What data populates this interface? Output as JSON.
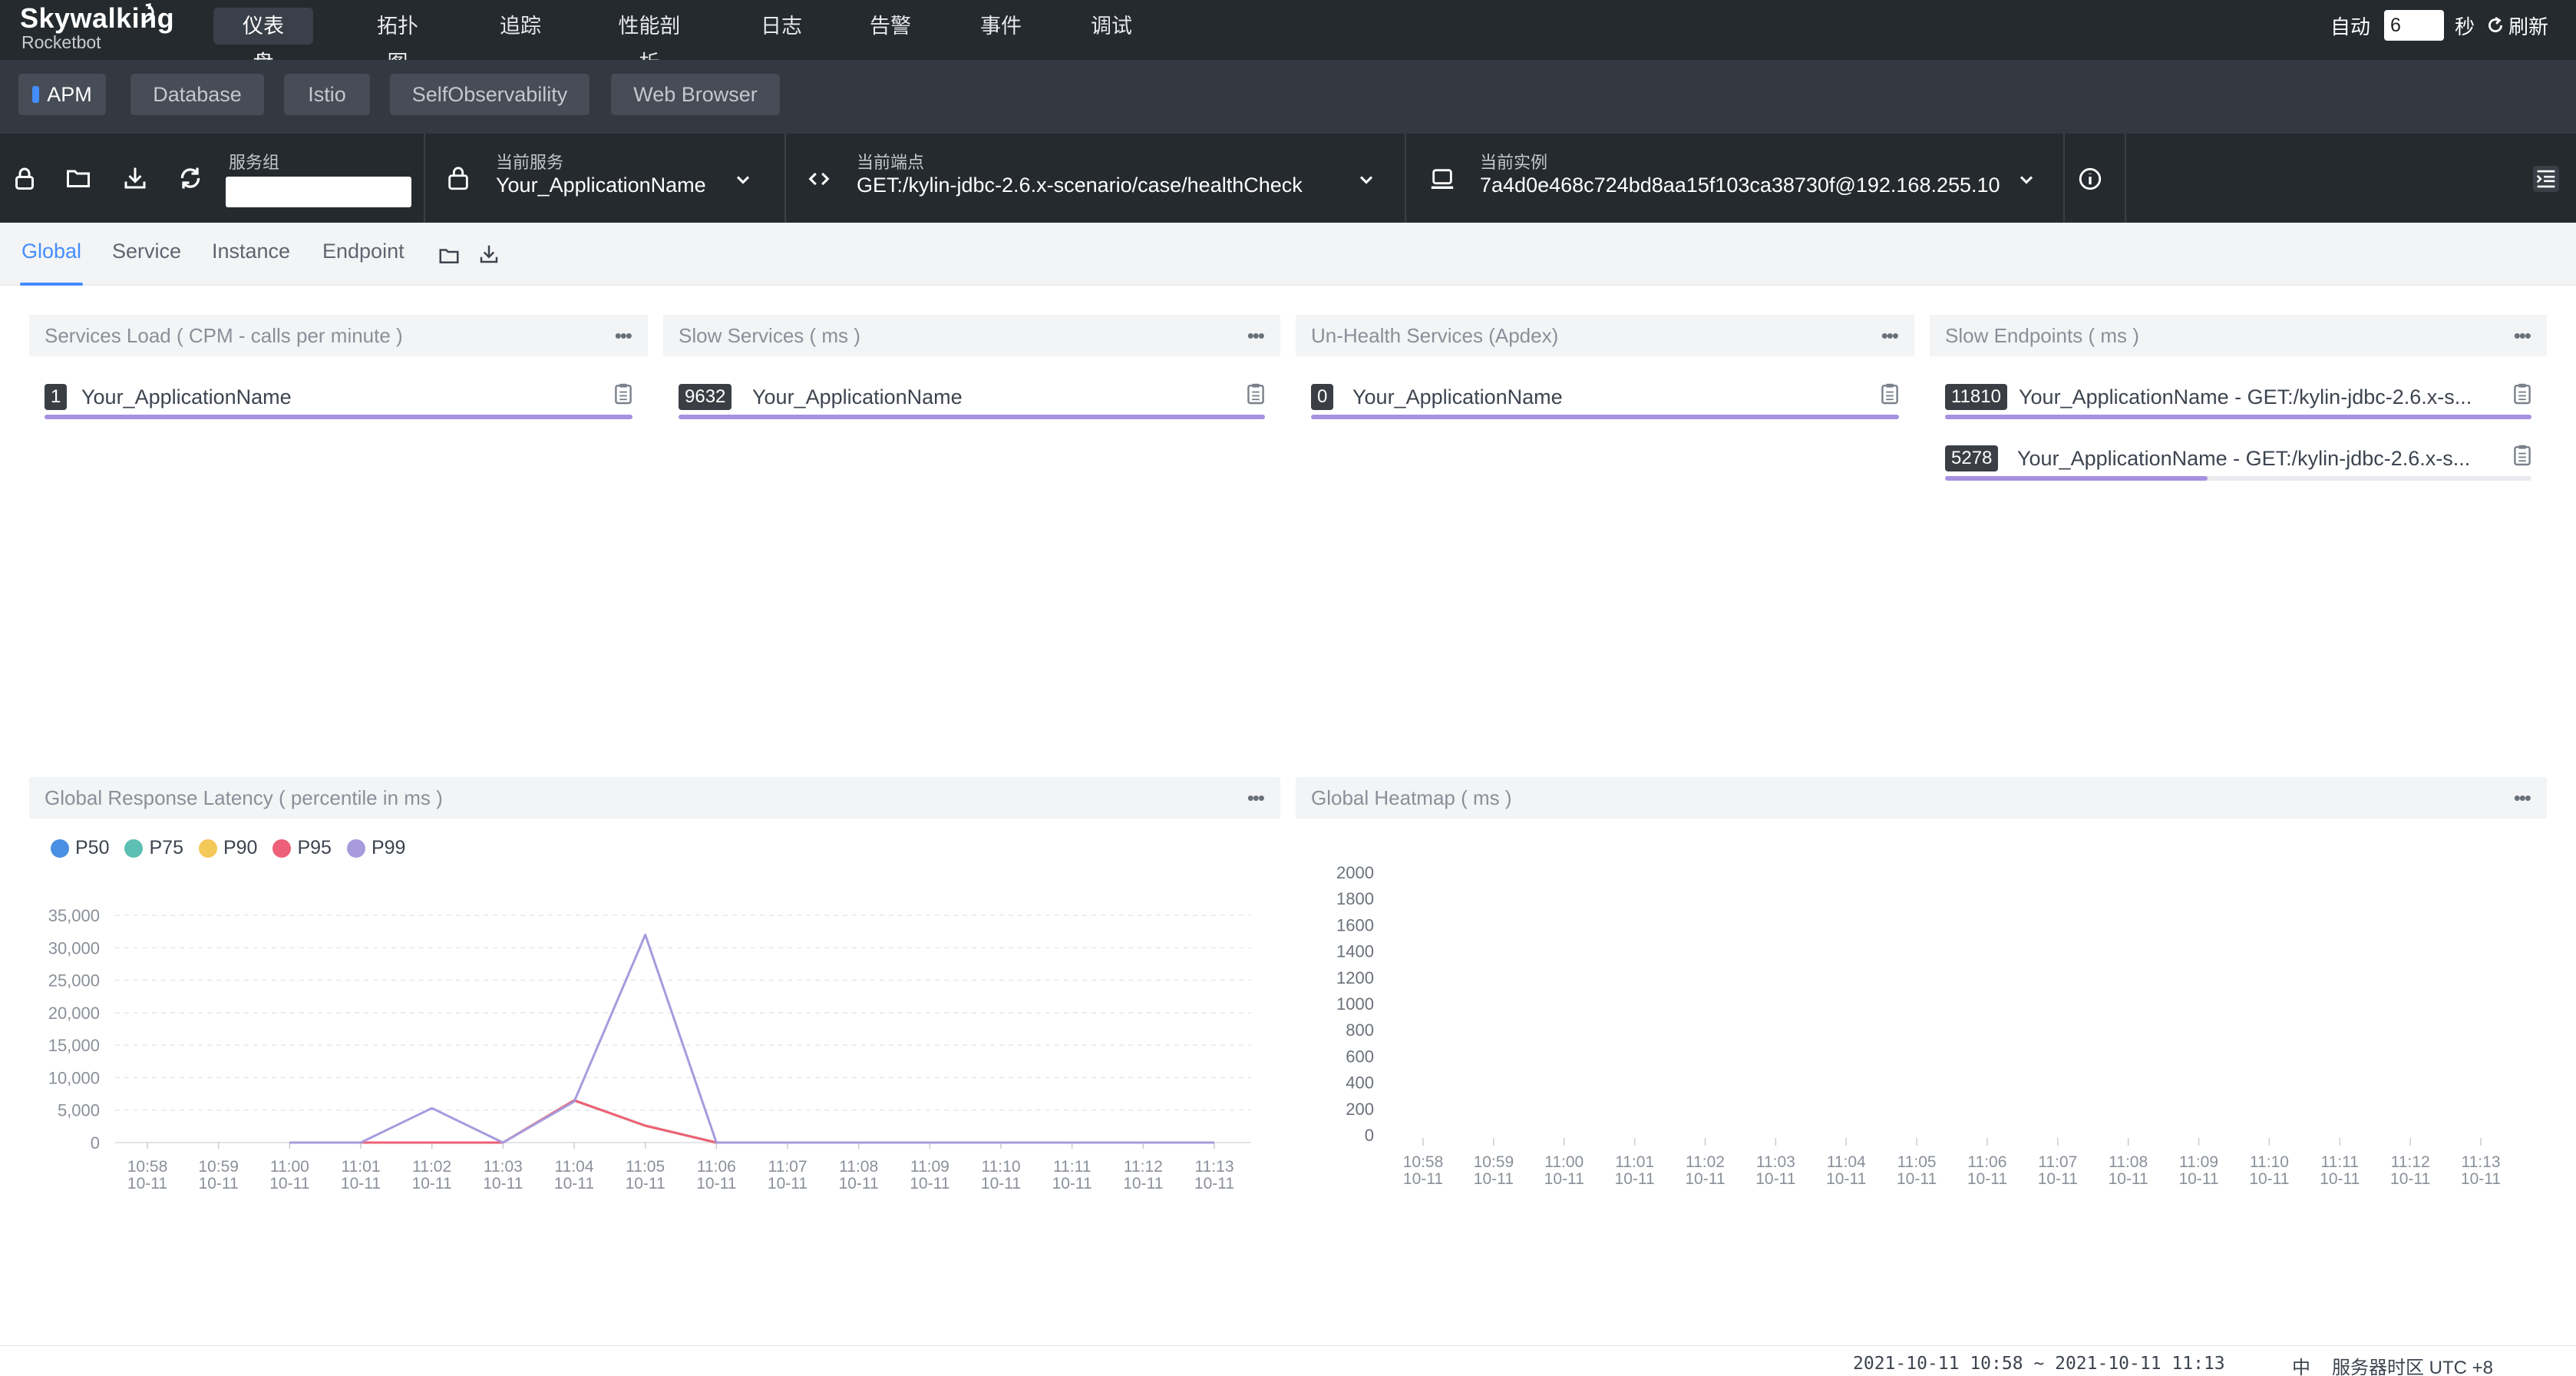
{
  "app": {
    "brand": "Skywalking",
    "subbrand": "Rocketbot"
  },
  "topnav": {
    "items": [
      "仪表盘",
      "拓扑图",
      "追踪",
      "性能剖析",
      "日志",
      "告警",
      "事件",
      "调试"
    ],
    "active_index": 0,
    "auto_label": "自动",
    "auto_value": "6",
    "seconds_label": "秒",
    "refresh_label": "刷新"
  },
  "layers": {
    "tabs": [
      "APM",
      "Database",
      "Istio",
      "SelfObservability",
      "Web Browser"
    ],
    "active_index": 0
  },
  "selectors": {
    "service_group_label": "服务组",
    "service_group_value": "",
    "service_label": "当前服务",
    "service_value": "Your_ApplicationName",
    "endpoint_label": "当前端点",
    "endpoint_value": "GET:/kylin-jdbc-2.6.x-scenario/case/healthCheck",
    "instance_label": "当前实例",
    "instance_value": "7a4d0e468c724bd8aa15f103ca38730f@192.168.255.10"
  },
  "dashboard_tabs": {
    "tabs": [
      "Global",
      "Service",
      "Instance",
      "Endpoint"
    ],
    "active_index": 0
  },
  "panels": {
    "services_load": {
      "title": "Services Load ( CPM - calls per minute )",
      "rows": [
        {
          "value": "1",
          "name": "Your_ApplicationName",
          "fill": 1.0
        }
      ]
    },
    "slow_services": {
      "title": "Slow Services ( ms )",
      "rows": [
        {
          "value": "9632",
          "name": "Your_ApplicationName",
          "fill": 1.0
        }
      ]
    },
    "unhealth_services": {
      "title": "Un-Health Services (Apdex)",
      "rows": [
        {
          "value": "0",
          "name": "Your_ApplicationName",
          "fill": 1.0
        }
      ]
    },
    "slow_endpoints": {
      "title": "Slow Endpoints ( ms )",
      "rows": [
        {
          "value": "11810",
          "name": "Your_ApplicationName - GET:/kylin-jdbc-2.6.x-s...",
          "fill": 1.0
        },
        {
          "value": "5278",
          "name": "Your_ApplicationName - GET:/kylin-jdbc-2.6.x-s...",
          "fill": 0.447
        }
      ]
    },
    "latency_title": "Global Response Latency ( percentile in ms )",
    "heatmap_title": "Global Heatmap ( ms )"
  },
  "chart_data": [
    {
      "type": "line",
      "title": "Global Response Latency ( percentile in ms )",
      "categories": [
        "10:58\n10-11",
        "10:59\n10-11",
        "11:00\n10-11",
        "11:01\n10-11",
        "11:02\n10-11",
        "11:03\n10-11",
        "11:04\n10-11",
        "11:05\n10-11",
        "11:06\n10-11",
        "11:07\n10-11",
        "11:08\n10-11",
        "11:09\n10-11",
        "11:10\n10-11",
        "11:11\n10-11",
        "11:12\n10-11",
        "11:13\n10-11"
      ],
      "series": [
        {
          "name": "P50",
          "color": "#4a90e2",
          "values": [
            null,
            null,
            0,
            0,
            0,
            0,
            6500,
            2600,
            0,
            0,
            0,
            0,
            0,
            0,
            0,
            0
          ]
        },
        {
          "name": "P75",
          "color": "#5ebfb4",
          "values": [
            null,
            null,
            0,
            0,
            0,
            0,
            6500,
            2600,
            0,
            0,
            0,
            0,
            0,
            0,
            0,
            0
          ]
        },
        {
          "name": "P90",
          "color": "#f5c85a",
          "values": [
            null,
            null,
            0,
            0,
            0,
            0,
            6500,
            2600,
            0,
            0,
            0,
            0,
            0,
            0,
            0,
            0
          ]
        },
        {
          "name": "P95",
          "color": "#ee6077",
          "values": [
            null,
            null,
            0,
            0,
            0,
            0,
            6500,
            2600,
            0,
            0,
            0,
            0,
            0,
            0,
            0,
            0
          ]
        },
        {
          "name": "P99",
          "color": "#a79bde",
          "values": [
            null,
            null,
            0,
            0,
            5300,
            0,
            6300,
            32000,
            0,
            0,
            0,
            0,
            0,
            0,
            0,
            0
          ]
        }
      ],
      "yticks": [
        "35,000",
        "30,000",
        "25,000",
        "20,000",
        "15,000",
        "10,000",
        "5,000",
        "0"
      ],
      "ylim": [
        0,
        35000
      ],
      "grid": true,
      "legend": "top-left"
    },
    {
      "type": "heatmap",
      "title": "Global Heatmap ( ms )",
      "categories": [
        "10:58\n10-11",
        "10:59\n10-11",
        "11:00\n10-11",
        "11:01\n10-11",
        "11:02\n10-11",
        "11:03\n10-11",
        "11:04\n10-11",
        "11:05\n10-11",
        "11:06\n10-11",
        "11:07\n10-11",
        "11:08\n10-11",
        "11:09\n10-11",
        "11:10\n10-11",
        "11:11\n10-11",
        "11:12\n10-11",
        "11:13\n10-11"
      ],
      "yticks": [
        "2000",
        "1800",
        "1600",
        "1400",
        "1200",
        "1000",
        "800",
        "600",
        "400",
        "200",
        "0"
      ],
      "ylim": [
        0,
        2000
      ],
      "values": []
    }
  ],
  "footer": {
    "time_range": "2021-10-11 10:58 ~ 2021-10-11 11:13",
    "lang": "中",
    "timezone": "服务器时区 UTC +8"
  }
}
